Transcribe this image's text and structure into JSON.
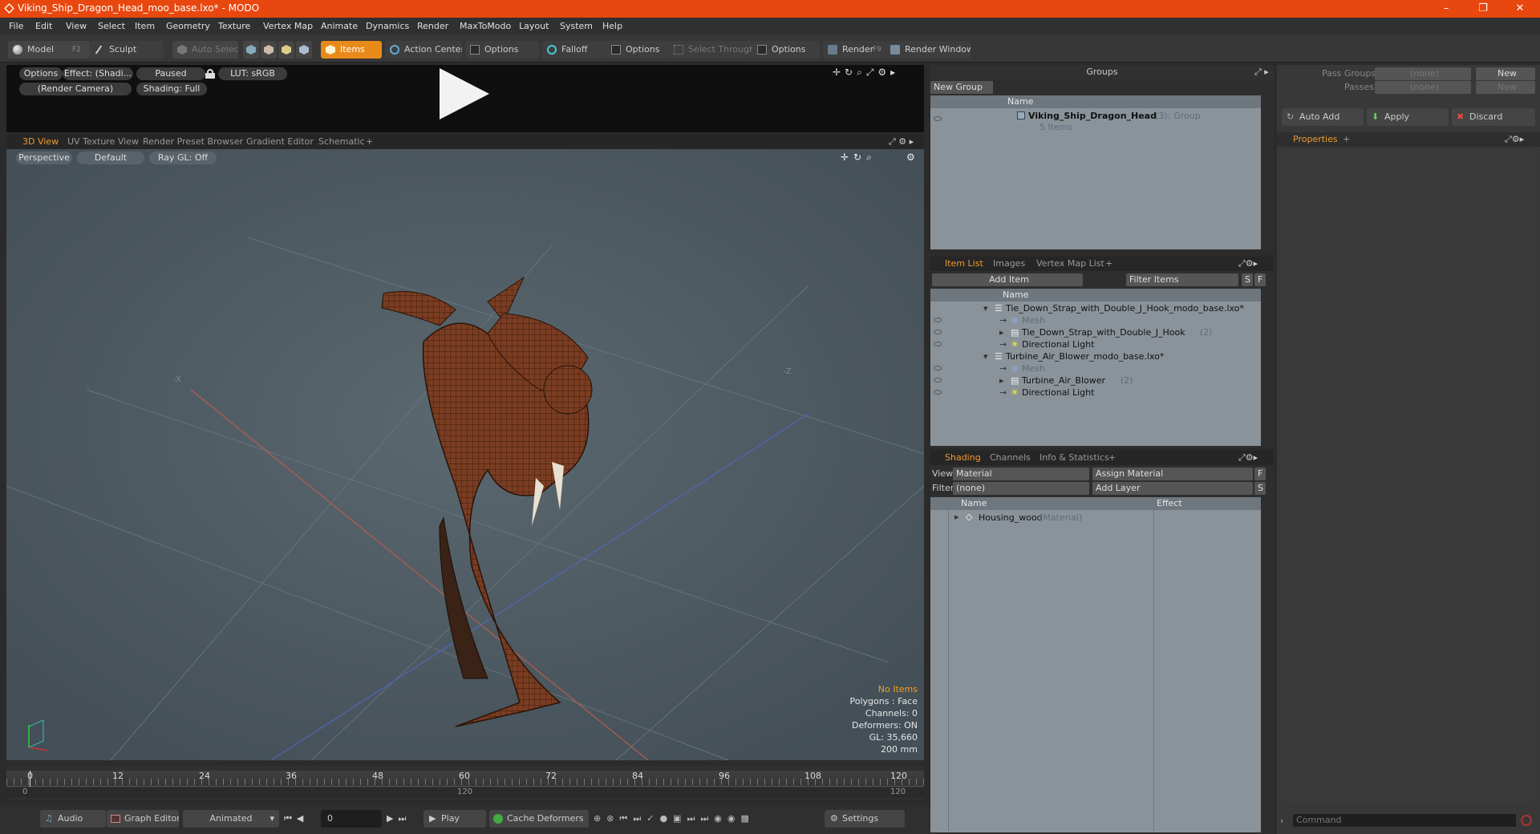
{
  "window": {
    "title": "Viking_Ship_Dragon_Head_moo_base.lxo* - MODO"
  },
  "menu": [
    "File",
    "Edit",
    "View",
    "Select",
    "Item",
    "Geometry",
    "Texture",
    "Vertex Map",
    "Animate",
    "Dynamics",
    "Render",
    "MaxToModo",
    "Layout",
    "System",
    "Help"
  ],
  "toolbar": {
    "model": "Model",
    "model_key": "F2",
    "sculpt": "Sculpt",
    "auto_select": "Auto Select",
    "items": "Items",
    "action_center": "Action Center",
    "options1": "Options",
    "falloff": "Falloff",
    "options2": "Options",
    "select_through": "Select Through",
    "options3": "Options",
    "render": "Render",
    "render_key": "F9",
    "render_window": "Render Window"
  },
  "preview": {
    "options": "Options",
    "effect": "Effect: (Shadi...",
    "paused": "Paused",
    "lut": "LUT: sRGB",
    "camera": "(Render Camera)",
    "shading": "Shading: Full"
  },
  "viewport_tabs": [
    "3D View",
    "UV Texture View",
    "Render Preset Browser",
    "Gradient Editor",
    "Schematic"
  ],
  "viewport": {
    "perspective": "Perspective",
    "default": "Default",
    "raygl": "Ray GL: Off",
    "axis_x": "-X",
    "axis_z": "-Z",
    "stats": {
      "items": "No Items",
      "polygons": "Polygons : Face",
      "channels": "Channels: 0",
      "deformers": "Deformers: ON",
      "gl": "GL: 35,660",
      "scale": "200 mm"
    }
  },
  "timeline": {
    "ticks": [
      "0",
      "12",
      "24",
      "36",
      "48",
      "60",
      "72",
      "84",
      "96",
      "108",
      "120"
    ],
    "end_left": "0",
    "mid": "120",
    "end_right": "120"
  },
  "bottom": {
    "audio": "Audio",
    "graph_editor": "Graph Editor",
    "animated": "Animated",
    "frame": "0",
    "play": "Play",
    "cache_deformers": "Cache Deformers",
    "settings": "Settings"
  },
  "groups": {
    "title": "Groups",
    "new_group": "New Group",
    "col_name": "Name",
    "item_name": "Viking_Ship_Dragon_Head",
    "item_count": "(3)",
    "item_type": ": Group",
    "item_sub": "5 Items"
  },
  "item_list": {
    "tabs": [
      "Item List",
      "Images",
      "Vertex Map List"
    ],
    "add_item": "Add Item",
    "filter": "Filter Items",
    "s": "S",
    "f": "F",
    "col_name": "Name",
    "rows": [
      {
        "label": "Tie_Down_Strap_with_Double_J_Hook_modo_base.lxo*",
        "count": "",
        "indent": 0,
        "kind": "scene"
      },
      {
        "label": "Mesh",
        "count": "",
        "indent": 1,
        "kind": "mesh"
      },
      {
        "label": "Tie_Down_Strap_with_Double_J_Hook",
        "count": "(2)",
        "indent": 1,
        "kind": "group"
      },
      {
        "label": "Directional Light",
        "count": "",
        "indent": 1,
        "kind": "light"
      },
      {
        "label": "Turbine_Air_Blower_modo_base.lxo*",
        "count": "",
        "indent": 0,
        "kind": "scene"
      },
      {
        "label": "Mesh",
        "count": "",
        "indent": 1,
        "kind": "mesh"
      },
      {
        "label": "Turbine_Air_Blower",
        "count": "(2)",
        "indent": 1,
        "kind": "group"
      },
      {
        "label": "Directional Light",
        "count": "",
        "indent": 1,
        "kind": "light"
      }
    ]
  },
  "shading": {
    "tabs": [
      "Shading",
      "Channels",
      "Info & Statistics"
    ],
    "view_label": "View",
    "view_value": "Material",
    "assign_material": "Assign Material",
    "f": "F",
    "filter_label": "Filter",
    "filter_value": "(none)",
    "add_layer": "Add Layer",
    "s": "S",
    "col_name": "Name",
    "col_effect": "Effect",
    "row_name": "Housing_wood",
    "row_type": "(Material)"
  },
  "passes": {
    "pass_groups": "Pass Groups",
    "pass_groups_value": "(none)",
    "new": "New",
    "passes": "Passes",
    "passes_value": "(none)",
    "new2": "New",
    "auto_add": "Auto Add",
    "apply": "Apply",
    "discard": "Discard",
    "properties": "Properties",
    "command": "Command"
  },
  "colors": {
    "accent": "#e8470f",
    "tab_active": "#f09a2a",
    "items_active": "#e88a1a",
    "model_wood": "#7a3d22"
  }
}
